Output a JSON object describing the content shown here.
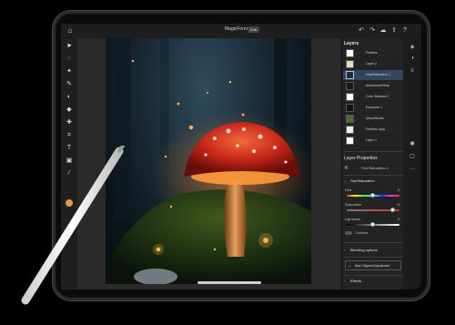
{
  "header": {
    "doc_title": "MagicForest",
    "doc_badge": "Edit"
  },
  "toolbar": {
    "tools": [
      "move-icon",
      "lasso-icon",
      "quick-select-icon",
      "brush-icon",
      "eraser-icon",
      "fill-icon",
      "retouch-icon",
      "crop-icon",
      "type-icon",
      "image-icon",
      "eyedropper-icon"
    ],
    "active_color": "#e39a45"
  },
  "layers_panel": {
    "title": "Layers",
    "layers": [
      {
        "name": "Fireflies",
        "selected": false
      },
      {
        "name": "Layer 2",
        "selected": false
      },
      {
        "name": "Hue/Saturation 1",
        "selected": true
      },
      {
        "name": "Mushroom/Final",
        "selected": false
      },
      {
        "name": "Color Balance 1",
        "selected": false
      },
      {
        "name": "Exposure 1",
        "selected": false
      },
      {
        "name": "Moss/Rocks",
        "selected": false
      },
      {
        "name": "Fireflies copy",
        "selected": false
      },
      {
        "name": "Layer 1",
        "selected": false
      }
    ]
  },
  "layer_properties": {
    "title": "Layer Properties",
    "layer_name": "Hue/Saturation 1",
    "section_title": "Hue/Saturation",
    "hue_label": "Hue",
    "hue_value": "0",
    "hue_level": 0.5,
    "saturation_label": "Saturation",
    "saturation_value": "+9",
    "saturation_level": 0.88,
    "lightness_label": "Lightness",
    "lightness_value": "0",
    "lightness_level": 0.5,
    "colorize_label": "Colorize",
    "blending_label": "Blending options",
    "add_clipped_label": "Add Clipped Adjustment",
    "effects_label": "Effects"
  },
  "colors": {
    "accent": "#3a78d8",
    "selected_layer": "#34465e",
    "mushroom_cap": "#d3321c"
  }
}
